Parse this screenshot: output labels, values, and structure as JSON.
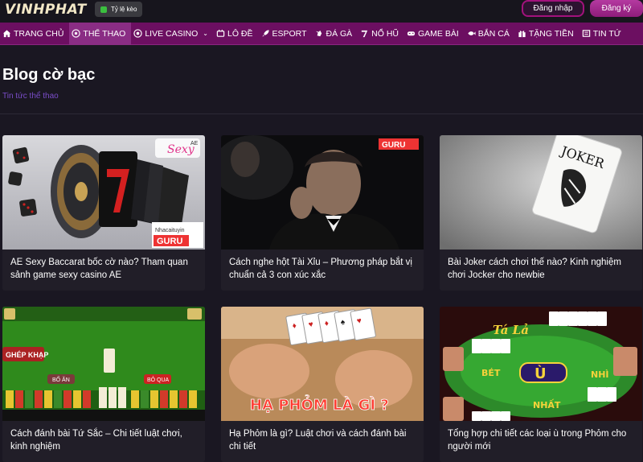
{
  "header": {
    "logo": "VINHPHAT",
    "odds_label": "Tỷ lệ kèo",
    "login_label": "Đăng nhập",
    "register_label": "Đăng ký"
  },
  "nav": {
    "items": [
      {
        "label": "TRANG CHỦ",
        "icon": "home-icon"
      },
      {
        "label": "THỂ THAO",
        "icon": "soccer-ball-icon",
        "active": true
      },
      {
        "label": "LIVE CASINO",
        "icon": "casino-chip-icon"
      },
      {
        "label": "LÔ ĐỀ",
        "icon": "lottery-icon"
      },
      {
        "label": "ESPORT",
        "icon": "rocket-icon"
      },
      {
        "label": "ĐÁ GÀ",
        "icon": "rooster-icon"
      },
      {
        "label": "NỔ HŨ",
        "icon": "slot-seven-icon"
      },
      {
        "label": "GAME BÀI",
        "icon": "gamepad-icon"
      },
      {
        "label": "BẮN CÁ",
        "icon": "fish-icon"
      },
      {
        "label": "TẶNG TIỀN",
        "icon": "gift-icon"
      },
      {
        "label": "TIN TỨ",
        "icon": "news-icon"
      }
    ]
  },
  "page": {
    "title": "Blog cờ bạc",
    "breadcrumb": "Tin tức thể thao"
  },
  "cards": [
    {
      "title": "AE Sexy Baccarat bốc cờ nào? Tham quan sảnh game sexy casino AE",
      "image_text": [
        "Sexy",
        "AE",
        "Nhacaituyin",
        "GURU"
      ]
    },
    {
      "title": "Cách nghe hột Tài Xỉu – Phương pháp bắt vị chuẩn cả 3 con xúc xắc",
      "image_text": [
        "GURU"
      ]
    },
    {
      "title": "Bài Joker cách chơi thế nào? Kinh nghiệm chơi Jocker cho newbie",
      "image_text": [
        "JOKER"
      ]
    },
    {
      "title": "Cách đánh bài Tứ Sắc – Chi tiết luật chơi, kinh nghiệm",
      "image_text": [
        "GHÉP KHẠP",
        "BỐ ĂN",
        "BỎ QUA"
      ]
    },
    {
      "title": "Hạ Phỏm là gì? Luật chơi và cách đánh bài chi tiết",
      "image_text": [
        "HẠ PHỎM LÀ GÌ ?"
      ]
    },
    {
      "title": "Tổng hợp chi tiết các loại ù trong Phỏm cho người mới",
      "image_text": [
        "Tá Lả",
        "Ù",
        "NHÌ",
        "BÉT",
        "NHẤT"
      ]
    }
  ]
}
